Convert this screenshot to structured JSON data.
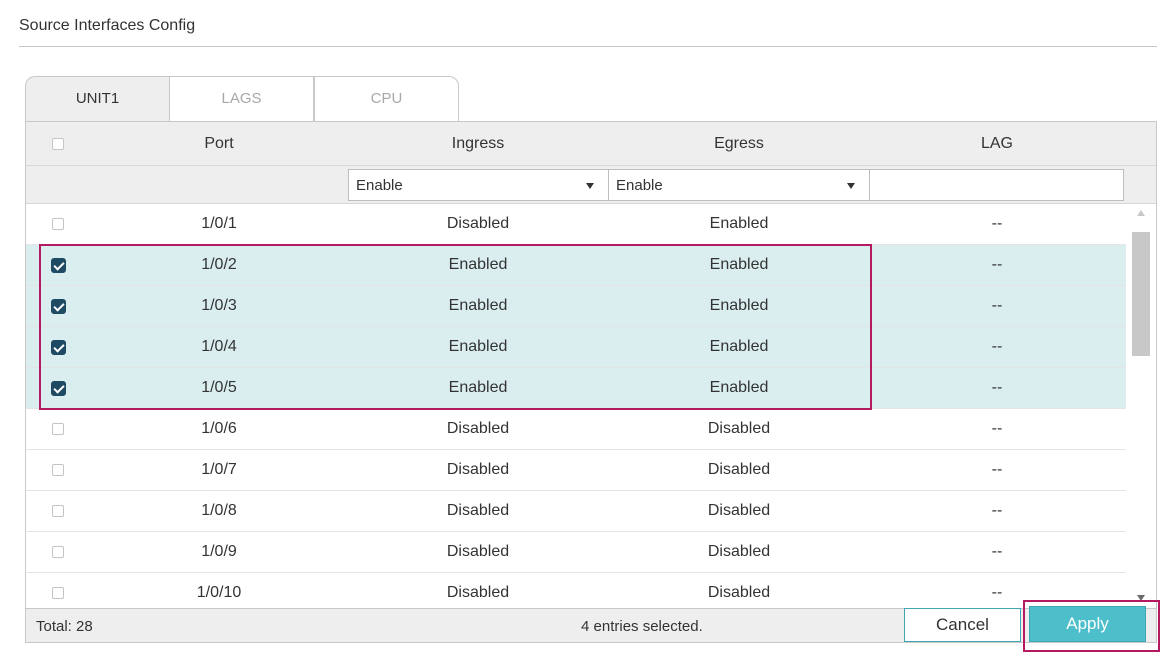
{
  "section_title": "Source Interfaces Config",
  "tabs": [
    {
      "label": "UNIT1",
      "active": true
    },
    {
      "label": "LAGS",
      "active": false
    },
    {
      "label": "CPU",
      "active": false
    }
  ],
  "columns": {
    "port": "Port",
    "ingress": "Ingress",
    "egress": "Egress",
    "lag": "LAG"
  },
  "filter": {
    "ingress": "Enable",
    "egress": "Enable"
  },
  "rows": [
    {
      "port": "1/0/1",
      "ingress": "Disabled",
      "egress": "Enabled",
      "lag": "--",
      "checked": false
    },
    {
      "port": "1/0/2",
      "ingress": "Enabled",
      "egress": "Enabled",
      "lag": "--",
      "checked": true
    },
    {
      "port": "1/0/3",
      "ingress": "Enabled",
      "egress": "Enabled",
      "lag": "--",
      "checked": true
    },
    {
      "port": "1/0/4",
      "ingress": "Enabled",
      "egress": "Enabled",
      "lag": "--",
      "checked": true
    },
    {
      "port": "1/0/5",
      "ingress": "Enabled",
      "egress": "Enabled",
      "lag": "--",
      "checked": true
    },
    {
      "port": "1/0/6",
      "ingress": "Disabled",
      "egress": "Disabled",
      "lag": "--",
      "checked": false
    },
    {
      "port": "1/0/7",
      "ingress": "Disabled",
      "egress": "Disabled",
      "lag": "--",
      "checked": false
    },
    {
      "port": "1/0/8",
      "ingress": "Disabled",
      "egress": "Disabled",
      "lag": "--",
      "checked": false
    },
    {
      "port": "1/0/9",
      "ingress": "Disabled",
      "egress": "Disabled",
      "lag": "--",
      "checked": false
    },
    {
      "port": "1/0/10",
      "ingress": "Disabled",
      "egress": "Disabled",
      "lag": "--",
      "checked": false
    }
  ],
  "footer": {
    "total": "Total: 28",
    "selected": "4 entries selected."
  },
  "buttons": {
    "cancel": "Cancel",
    "apply": "Apply"
  },
  "colors": {
    "accent": "#4cbfcb",
    "selected_row": "#daeef0",
    "checkbox": "#1f4a63",
    "highlight": "#b5195f"
  }
}
